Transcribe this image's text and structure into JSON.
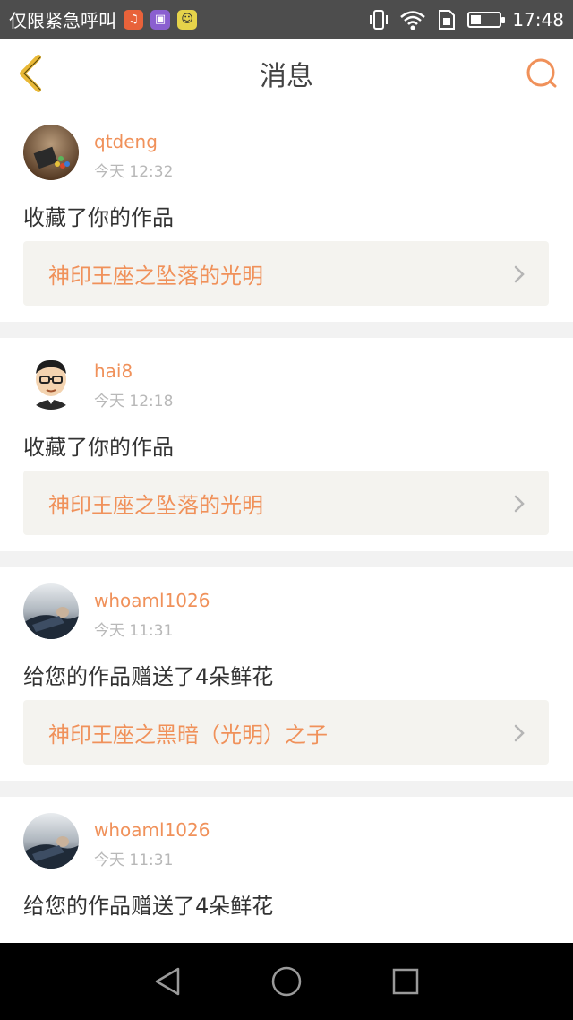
{
  "status_bar": {
    "carrier": "仅限紧急呼叫",
    "time": "17:48",
    "battery_level": 0.35,
    "app_icons": [
      "music-icon",
      "gallery-icon",
      "chat-icon"
    ],
    "indicators": [
      "vibrate-icon",
      "wifi-icon",
      "sim-icon",
      "battery-icon"
    ]
  },
  "nav": {
    "title": "消息",
    "back_icon": "back-chevron-icon",
    "search_icon": "search-icon"
  },
  "colors": {
    "accent": "#f0915a",
    "title": "#444444",
    "back": "#e9b835",
    "muted": "#b8b8b8"
  },
  "messages": [
    {
      "username": "qtdeng",
      "time": "今天 12:32",
      "action": "收藏了你的作品",
      "work_title": "神印王座之坠落的光明"
    },
    {
      "username": "hai8",
      "time": "今天 12:18",
      "action": "收藏了你的作品",
      "work_title": "神印王座之坠落的光明"
    },
    {
      "username": "whoaml1026",
      "time": "今天 11:31",
      "action": "给您的作品赠送了4朵鲜花",
      "work_title": "神印王座之黑暗（光明）之子"
    },
    {
      "username": "whoaml1026",
      "time": "今天 11:31",
      "action": "给您的作品赠送了4朵鲜花",
      "work_title": ""
    }
  ],
  "system_nav": {
    "keys": [
      "back-triangle-icon",
      "home-circle-icon",
      "recents-square-icon"
    ]
  }
}
